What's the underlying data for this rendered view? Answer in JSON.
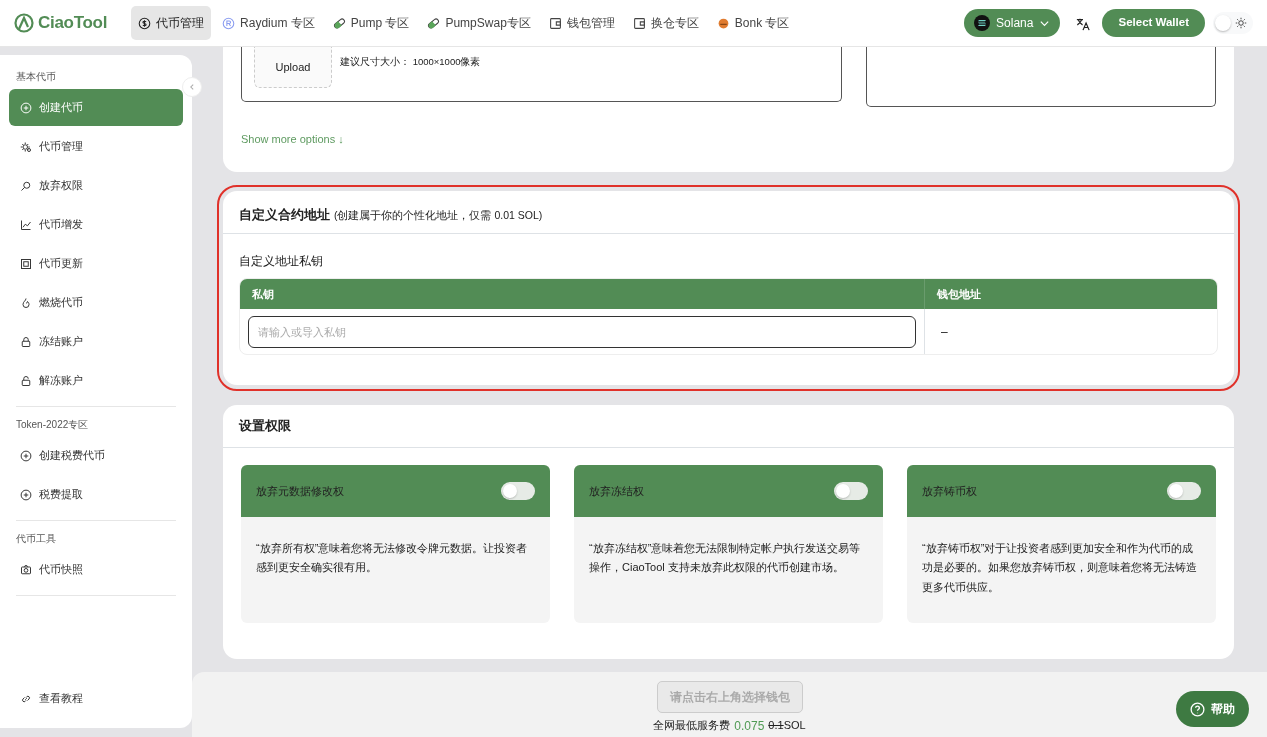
{
  "navbar": {
    "logo": "CiaoTool",
    "tabs": [
      {
        "label": "代币管理",
        "kind": "dollar",
        "selected": true
      },
      {
        "label": "Raydium 专区",
        "kind": "raydium",
        "selected": false
      },
      {
        "label": "Pump 专区",
        "kind": "pill",
        "selected": false
      },
      {
        "label": "PumpSwap专区",
        "kind": "pill",
        "selected": false
      },
      {
        "label": "钱包管理",
        "kind": "wallet",
        "selected": false
      },
      {
        "label": "换仓专区",
        "kind": "wallet",
        "selected": false
      },
      {
        "label": "Bonk 专区",
        "kind": "bonk",
        "selected": false
      }
    ],
    "network": "Solana",
    "wallet_button": "Select Wallet",
    "dark_mode": false
  },
  "sidebar": {
    "sections": [
      {
        "heading": "基本代币",
        "items": [
          {
            "label": "创建代币",
            "kind": "plus",
            "selected": true
          },
          {
            "label": "代币管理",
            "kind": "gear",
            "selected": false
          },
          {
            "label": "放弃权限",
            "kind": "search",
            "selected": false
          },
          {
            "label": "代币增发",
            "kind": "chart",
            "selected": false
          },
          {
            "label": "代币更新",
            "kind": "square",
            "selected": false
          },
          {
            "label": "燃烧代币",
            "kind": "flame",
            "selected": false
          },
          {
            "label": "冻结账户",
            "kind": "lock",
            "selected": false
          },
          {
            "label": "解冻账户",
            "kind": "unlock",
            "selected": false
          }
        ]
      },
      {
        "heading": "Token-2022专区",
        "items": [
          {
            "label": "创建税费代币",
            "kind": "plus",
            "selected": false
          },
          {
            "label": "税费提取",
            "kind": "plus",
            "selected": false
          }
        ]
      },
      {
        "heading": "代币工具",
        "items": [
          {
            "label": "代币快照",
            "kind": "camera",
            "selected": false
          }
        ]
      }
    ],
    "footer_link": "查看教程"
  },
  "token_form": {
    "upload_label": "Upload",
    "upload_hint": "建议尺寸大小： 1000×1000像素",
    "show_more": "Show more options ↓"
  },
  "custom_address": {
    "highlighted": true,
    "title": "自定义合约地址",
    "subtitle": "(创建属于你的个性化地址，仅需 0.01 SOL)",
    "field_label": "自定义地址私钥",
    "columns": [
      "私钥",
      "钱包地址"
    ],
    "placeholder": "请输入或导入私钥",
    "wallet_address": "–"
  },
  "permissions": {
    "title": "设置权限",
    "cards": [
      {
        "title": "放弃元数据修改权",
        "on": false,
        "description": "“放弃所有权”意味着您将无法修改令牌元数据。让投资者感到更安全确实很有用。"
      },
      {
        "title": "放弃冻结权",
        "on": false,
        "description": "“放弃冻结权”意味着您无法限制特定帐户执行发送交易等操作，CiaoTool 支持未放弃此权限的代币创建市场。"
      },
      {
        "title": "放弃铸币权",
        "on": false,
        "description": "“放弃铸币权”对于让投资者感到更加安全和作为代币的成功是必要的。如果您放弃铸币权，则意味着您将无法铸造更多代币供应。"
      }
    ]
  },
  "footer": {
    "submit_button": "请点击右上角选择钱包",
    "disabled": true,
    "fee_label": "全网最低服务费",
    "fee": "0.075",
    "old_fee": "0.1",
    "unit": "SOL",
    "help_button": "帮助"
  }
}
